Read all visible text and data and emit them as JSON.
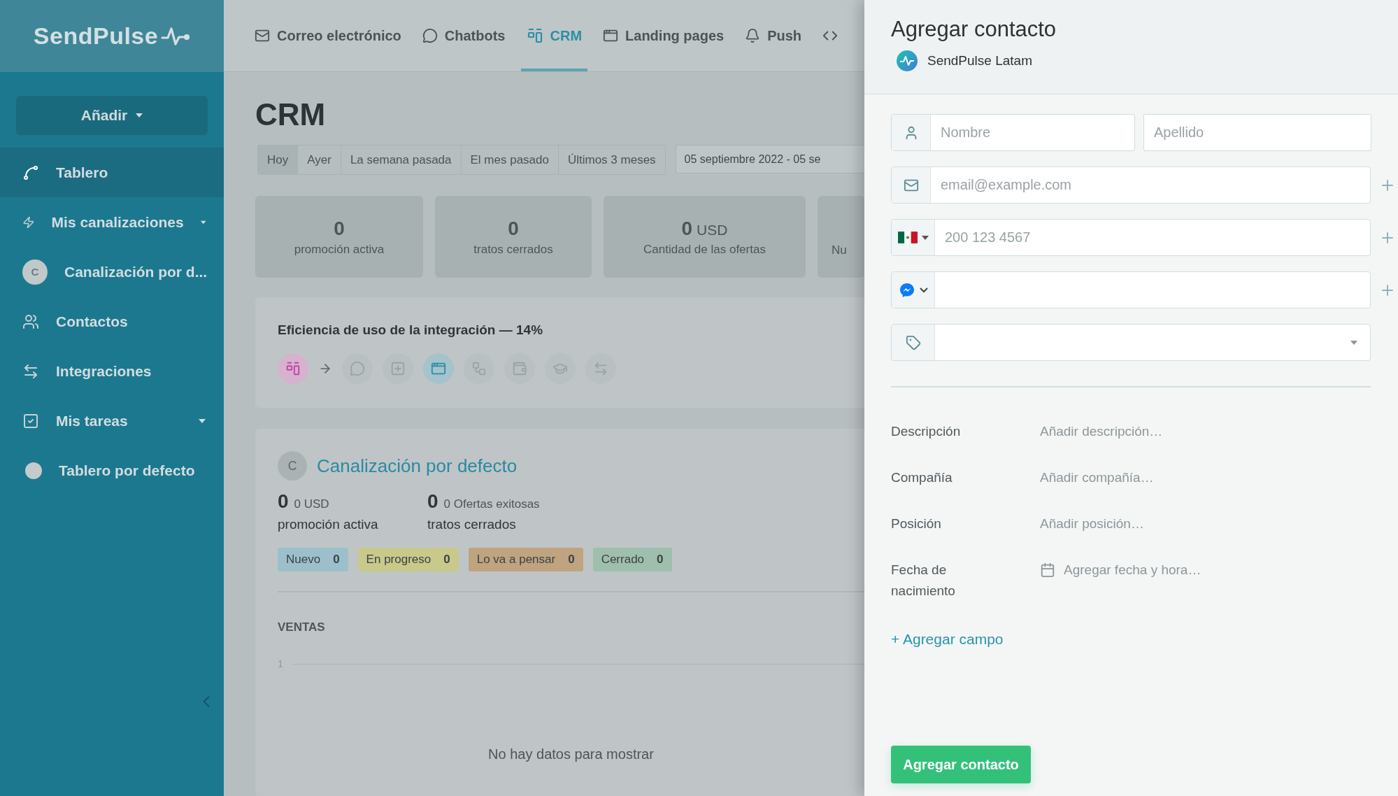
{
  "sidebar": {
    "logo": "SendPulse",
    "add_button": "Añadir",
    "items": [
      {
        "label": "Tablero",
        "kind": "chart",
        "selected": true,
        "expandable": false
      },
      {
        "label": "Mis canalizaciones",
        "kind": "lightning",
        "selected": false,
        "expandable": true
      },
      {
        "label": "Canalización por d...",
        "kind": "avatar",
        "avatar": "C",
        "selected": false,
        "expandable": false
      },
      {
        "label": "Contactos",
        "kind": "contacts",
        "selected": false,
        "expandable": false
      },
      {
        "label": "Integraciones",
        "kind": "arrows",
        "selected": false,
        "expandable": false
      },
      {
        "label": "Mis tareas",
        "kind": "tasks",
        "selected": false,
        "expandable": true
      },
      {
        "label": "Tablero por defecto",
        "kind": "dot",
        "selected": false,
        "expandable": false
      }
    ]
  },
  "nav": {
    "tabs": [
      {
        "label": "Correo electrónico",
        "kind": "mail",
        "selected": false
      },
      {
        "label": "Chatbots",
        "kind": "chat",
        "selected": false
      },
      {
        "label": "CRM",
        "kind": "crm",
        "selected": true
      },
      {
        "label": "Landing pages",
        "kind": "window",
        "selected": false
      },
      {
        "label": "Push",
        "kind": "bell",
        "selected": false
      },
      {
        "kind": "code",
        "selected": false
      }
    ]
  },
  "main": {
    "title": "CRM",
    "periods": [
      {
        "label": "Hoy",
        "selected": true
      },
      {
        "label": "Ayer",
        "selected": false
      },
      {
        "label": "La semana pasada",
        "selected": false
      },
      {
        "label": "El mes pasado",
        "selected": false
      },
      {
        "label": "Últimos 3 meses",
        "selected": false
      }
    ],
    "date_range": "05 septiembre 2022 - 05 se",
    "stats": [
      {
        "value": "0",
        "label": "promoción activa"
      },
      {
        "value": "0",
        "label": "tratos cerrados"
      },
      {
        "value": "0",
        "unit": "USD",
        "label": "Cantidad de las ofertas"
      },
      {
        "label": "Nu"
      }
    ]
  },
  "efficiency": {
    "title": "Eficiencia de uso de la integración — 14%",
    "integrations": [
      {
        "kind": "crm",
        "active": true
      },
      {
        "kind": "arrow",
        "active": false
      },
      {
        "kind": "chat",
        "active": false
      },
      {
        "kind": "popup",
        "active": false
      },
      {
        "kind": "window",
        "active": true
      },
      {
        "kind": "automation",
        "active": false
      },
      {
        "kind": "wallet",
        "active": false
      },
      {
        "kind": "education",
        "active": false
      },
      {
        "kind": "arrows",
        "active": false
      }
    ]
  },
  "pipeline": {
    "avatar": "C",
    "title": "Canalización por defecto",
    "stats": [
      {
        "value": "0",
        "detail": "0 USD",
        "label": "promoción activa"
      },
      {
        "value": "0",
        "detail": "0 Ofertas exitosas",
        "label": "tratos cerrados"
      }
    ],
    "stages": [
      {
        "label": "Nuevo",
        "count": "0",
        "color": "#9cc0cb"
      },
      {
        "label": "En progreso",
        "count": "0",
        "color": "#c8c98b"
      },
      {
        "label": "Lo va a pensar",
        "count": "0",
        "color": "#bfa47f"
      },
      {
        "label": "Cerrado",
        "count": "0",
        "color": "#9fbfad"
      }
    ],
    "sales": {
      "title": "VENTAS",
      "tick": "1",
      "empty": "No hay datos para mostrar"
    }
  },
  "panel": {
    "title": "Agregar contacto",
    "account": "SendPulse Latam",
    "fields": [
      {
        "kind": "name",
        "placeholder": "Nombre",
        "second_placeholder": "Apellido",
        "addable": false
      },
      {
        "kind": "email",
        "placeholder": "email@example.com",
        "addable": true
      },
      {
        "kind": "phone",
        "placeholder": "200 123 4567",
        "addable": true
      },
      {
        "kind": "messenger",
        "addable": true
      },
      {
        "kind": "tags",
        "addable": false
      }
    ],
    "details": [
      {
        "kind": "text",
        "label": "Descripción",
        "placeholder": "Añadir descripción…"
      },
      {
        "kind": "text",
        "label": "Compañía",
        "placeholder": "Añadir compañía…"
      },
      {
        "kind": "text",
        "label": "Posición",
        "placeholder": "Añadir posición…"
      },
      {
        "kind": "date",
        "label": "Fecha de nacimiento",
        "placeholder": "Agregar fecha y hora…"
      }
    ],
    "add_field": "+ Agregar campo",
    "submit": "Agregar contacto"
  }
}
